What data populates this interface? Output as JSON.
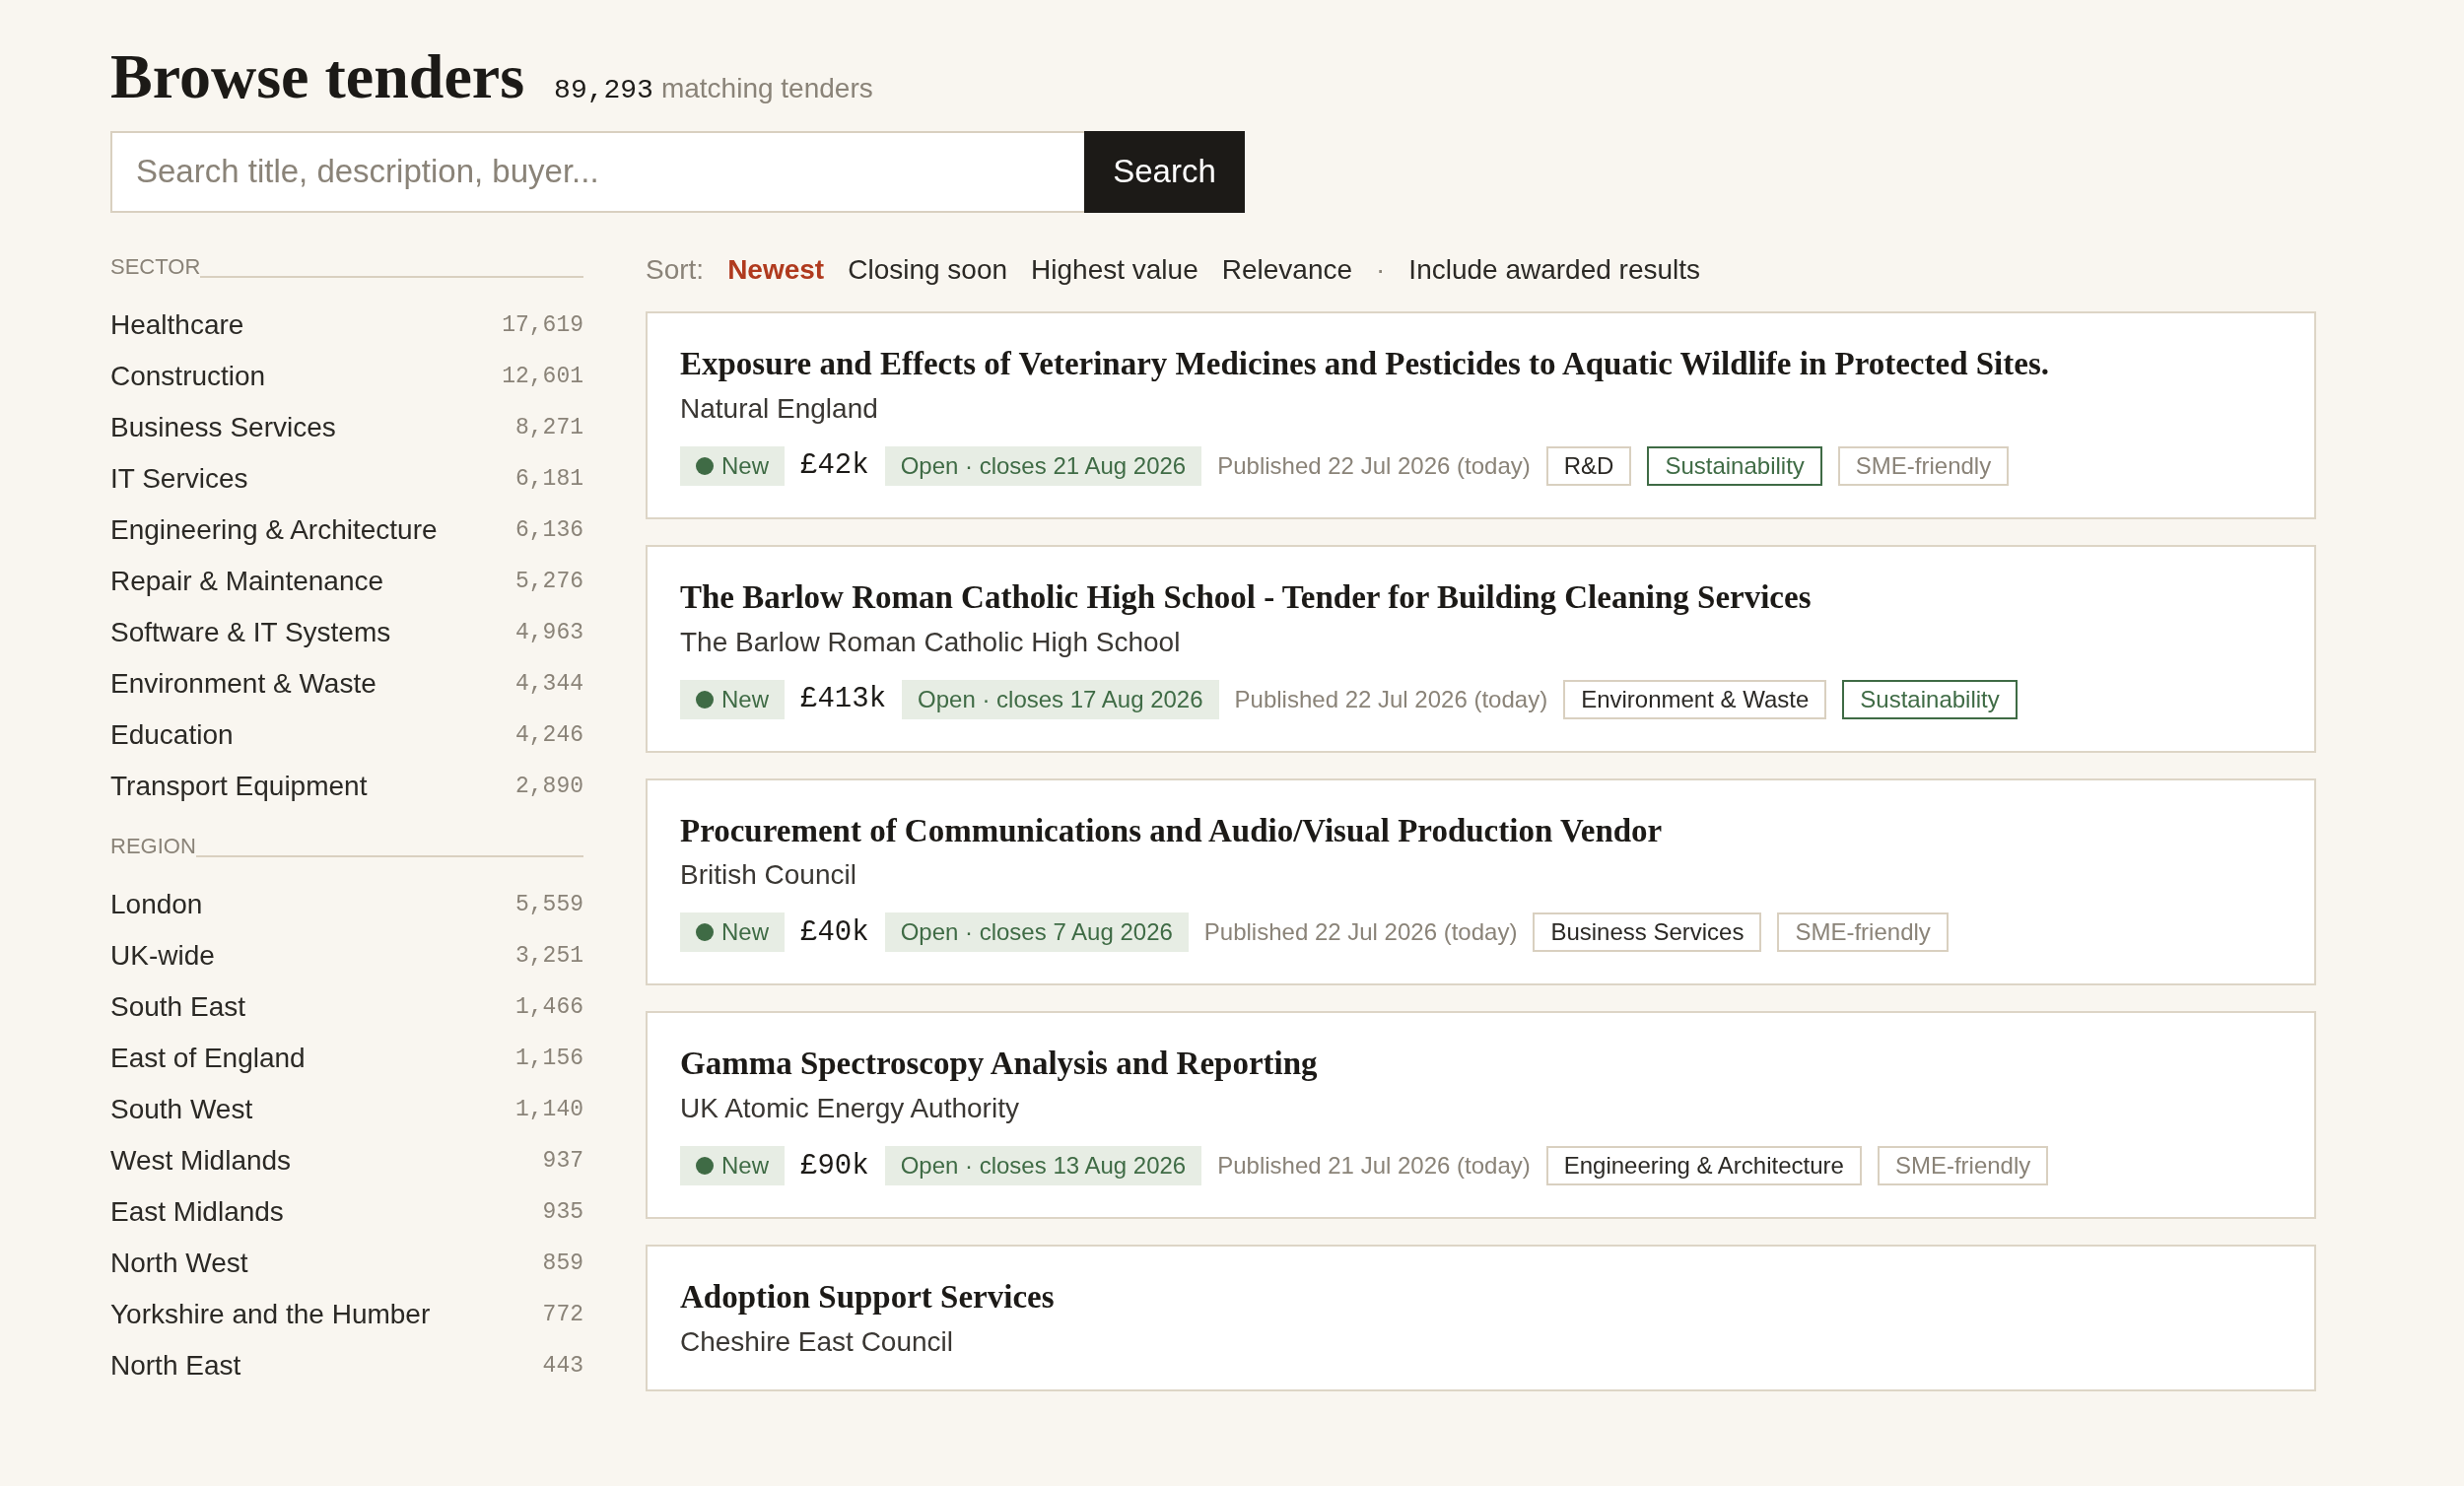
{
  "header": {
    "title": "Browse tenders",
    "count": "89,293",
    "count_label": "matching tenders"
  },
  "search": {
    "placeholder": "Search title, description, buyer...",
    "button": "Search"
  },
  "sidebar": {
    "sections": [
      {
        "heading": "SECTOR",
        "items": [
          {
            "label": "Healthcare",
            "count": "17,619"
          },
          {
            "label": "Construction",
            "count": "12,601"
          },
          {
            "label": "Business Services",
            "count": "8,271"
          },
          {
            "label": "IT Services",
            "count": "6,181"
          },
          {
            "label": "Engineering & Architecture",
            "count": "6,136"
          },
          {
            "label": "Repair & Maintenance",
            "count": "5,276"
          },
          {
            "label": "Software & IT Systems",
            "count": "4,963"
          },
          {
            "label": "Environment & Waste",
            "count": "4,344"
          },
          {
            "label": "Education",
            "count": "4,246"
          },
          {
            "label": "Transport Equipment",
            "count": "2,890"
          }
        ]
      },
      {
        "heading": "REGION",
        "items": [
          {
            "label": "London",
            "count": "5,559"
          },
          {
            "label": "UK-wide",
            "count": "3,251"
          },
          {
            "label": "South East",
            "count": "1,466"
          },
          {
            "label": "East of England",
            "count": "1,156"
          },
          {
            "label": "South West",
            "count": "1,140"
          },
          {
            "label": "West Midlands",
            "count": "937"
          },
          {
            "label": "East Midlands",
            "count": "935"
          },
          {
            "label": "North West",
            "count": "859"
          },
          {
            "label": "Yorkshire and the Humber",
            "count": "772"
          },
          {
            "label": "North East",
            "count": "443"
          }
        ]
      }
    ]
  },
  "sort": {
    "label": "Sort:",
    "options": [
      {
        "label": "Newest",
        "selected": true
      },
      {
        "label": "Closing soon",
        "selected": false
      },
      {
        "label": "Highest value",
        "selected": false
      },
      {
        "label": "Relevance",
        "selected": false
      }
    ],
    "separator": "·",
    "awarded_link": "Include awarded results"
  },
  "tenders": [
    {
      "title": "Exposure and Effects of Veterinary Medicines and Pesticides to Aquatic Wildlife in Protected Sites.",
      "buyer": "Natural England",
      "badge": "New",
      "value": "£42k",
      "status": "Open · closes 21 Aug 2026",
      "published": "Published 22 Jul 2026 (today)",
      "tags": [
        {
          "label": "R&D",
          "kind": "sector"
        },
        {
          "label": "Sustainability",
          "kind": "green"
        },
        {
          "label": "SME-friendly",
          "kind": "muted"
        }
      ]
    },
    {
      "title": "The Barlow Roman Catholic High School - Tender for Building Cleaning Services",
      "buyer": "The Barlow Roman Catholic High School",
      "badge": "New",
      "value": "£413k",
      "status": "Open · closes 17 Aug 2026",
      "published": "Published 22 Jul 2026 (today)",
      "tags": [
        {
          "label": "Environment & Waste",
          "kind": "sector"
        },
        {
          "label": "Sustainability",
          "kind": "green"
        }
      ]
    },
    {
      "title": "Procurement of Communications and Audio/Visual Production Vendor",
      "buyer": "British Council",
      "badge": "New",
      "value": "£40k",
      "status": "Open · closes 7 Aug 2026",
      "published": "Published 22 Jul 2026 (today)",
      "tags": [
        {
          "label": "Business Services",
          "kind": "sector"
        },
        {
          "label": "SME-friendly",
          "kind": "muted"
        }
      ]
    },
    {
      "title": "Gamma Spectroscopy Analysis and Reporting",
      "buyer": "UK Atomic Energy Authority",
      "badge": "New",
      "value": "£90k",
      "status": "Open · closes 13 Aug 2026",
      "published": "Published 21 Jul 2026 (today)",
      "tags": [
        {
          "label": "Engineering & Architecture",
          "kind": "sector"
        },
        {
          "label": "SME-friendly",
          "kind": "muted"
        }
      ]
    },
    {
      "title": "Adoption Support Services",
      "buyer": "Cheshire East Council"
    }
  ]
}
